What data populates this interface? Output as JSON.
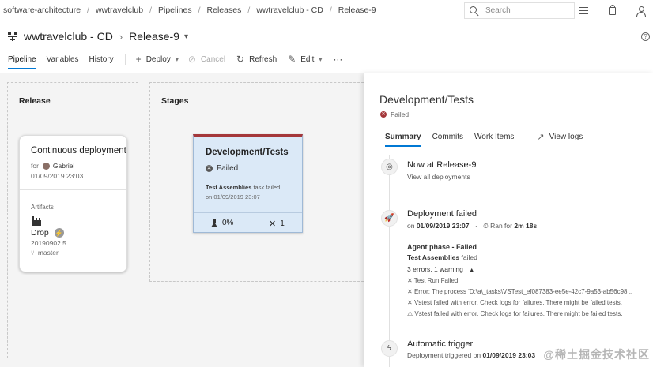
{
  "breadcrumb": [
    "software-architecture",
    "wwtravelclub",
    "Pipelines",
    "Releases",
    "wwtravelclub - CD",
    "Release-9"
  ],
  "search": {
    "placeholder": "Search"
  },
  "title": {
    "pipeline": "wwtravelclub - CD",
    "release": "Release-9"
  },
  "tabs": [
    {
      "label": "Pipeline",
      "active": true
    },
    {
      "label": "Variables",
      "active": false
    },
    {
      "label": "History",
      "active": false
    }
  ],
  "toolbar": {
    "deploy": "Deploy",
    "cancel": "Cancel",
    "refresh": "Refresh",
    "edit": "Edit",
    "more": "···"
  },
  "canvas": {
    "release_title": "Release",
    "stages_title": "Stages",
    "cd_card": {
      "title": "Continuous deployment",
      "for_label": "for",
      "user": "Gabriel",
      "date": "01/09/2019 23:03",
      "artifacts_label": "Artifacts",
      "artifact_name": "Drop",
      "artifact_version": "20190902.5",
      "artifact_branch": "master"
    },
    "stage_card": {
      "title": "Development/Tests",
      "status": "Failed",
      "task_name": "Test Assemblies",
      "task_suffix": " task failed",
      "date": "on 01/09/2019 23:07",
      "tests_pct": "0%",
      "errors": "1"
    }
  },
  "panel": {
    "title": "Development/Tests",
    "status": "Failed",
    "tabs": [
      "Summary",
      "Commits",
      "Work Items"
    ],
    "view_logs": "View logs",
    "now_at_prefix": "Now at ",
    "now_at_release": "Release-9",
    "view_all": "View all deployments",
    "deploy_failed": "Deployment failed",
    "deploy_on_prefix": "on ",
    "deploy_date": "01/09/2019 23:07",
    "deploy_ran_prefix": "Ran for ",
    "deploy_duration": "2m 18s",
    "agent_phase": "Agent phase - Failed",
    "phase_task": "Test Assemblies",
    "phase_task_suffix": " failed",
    "errors_summary": "3 errors, 1 warning",
    "messages": [
      "Test Run Failed.",
      "Error: The process 'D:\\a\\_tasks\\VSTest_ef087383-ee5e-42c7-9a53-ab56c98...",
      "Vstest failed with error. Check logs for failures. There might be failed tests.",
      "Vstest failed with error. Check logs for failures. There might be failed tests."
    ],
    "trigger_title": "Automatic trigger",
    "trigger_prefix": "Deployment triggered on ",
    "trigger_date": "01/09/2019 23:03"
  },
  "watermark": "@稀土掘金技术社区",
  "colors": {
    "accent": "#0078d4",
    "failed": "#a4373a",
    "stage_bg": "#dbe9f7"
  }
}
